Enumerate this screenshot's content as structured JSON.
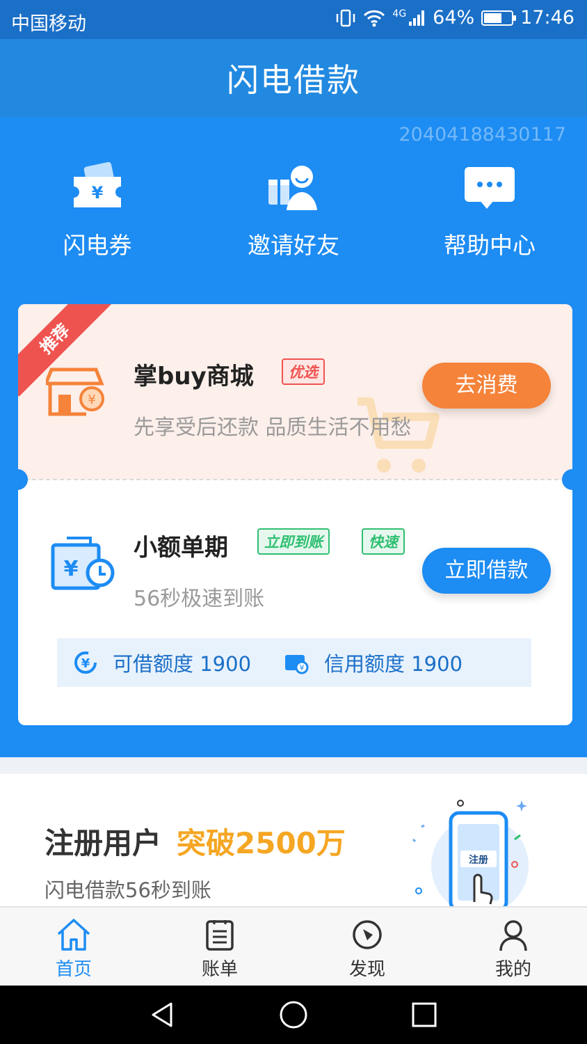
{
  "status_bar": {
    "carrier": "中国移动",
    "network": "4G",
    "battery": "64%",
    "battery_level": 0.64,
    "time": "17:46"
  },
  "header": {
    "title": "闪电借款"
  },
  "user_id": "20404188430117",
  "quick_actions": [
    {
      "label": "闪电券",
      "icon": "coupon-icon"
    },
    {
      "label": "邀请好友",
      "icon": "invite-friend-icon"
    },
    {
      "label": "帮助中心",
      "icon": "chat-bubble-icon"
    }
  ],
  "card": {
    "ribbon": "推荐",
    "featured": {
      "title": "掌buy商城",
      "tag": "优选",
      "subtitle": "先享受后还款 品质生活不用愁",
      "button": "去消费"
    },
    "loan": {
      "title": "小额单期",
      "tags": [
        "立即到账",
        "快速"
      ],
      "subtitle": "56秒极速到账",
      "button": "立即借款"
    },
    "limits": [
      {
        "label": "可借额度 1900",
        "icon": "yuan-circle-icon"
      },
      {
        "label": "信用额度 1900",
        "icon": "credit-card-icon"
      }
    ]
  },
  "promo": {
    "title": "注册用户",
    "highlight": "突破2500万",
    "subtitle": "闪电借款56秒到账",
    "phone_label": "注册"
  },
  "tabs": [
    {
      "label": "首页",
      "icon": "home-icon",
      "active": true
    },
    {
      "label": "账单",
      "icon": "bill-icon",
      "active": false
    },
    {
      "label": "发现",
      "icon": "compass-icon",
      "active": false
    },
    {
      "label": "我的",
      "icon": "user-icon",
      "active": false
    }
  ],
  "colors": {
    "header": "#2289e0",
    "blue": "#1d8cf3",
    "orange": "#f5833a",
    "green": "#2fbf71",
    "tag_red": "#ef5350",
    "highlight": "#f5a623"
  }
}
